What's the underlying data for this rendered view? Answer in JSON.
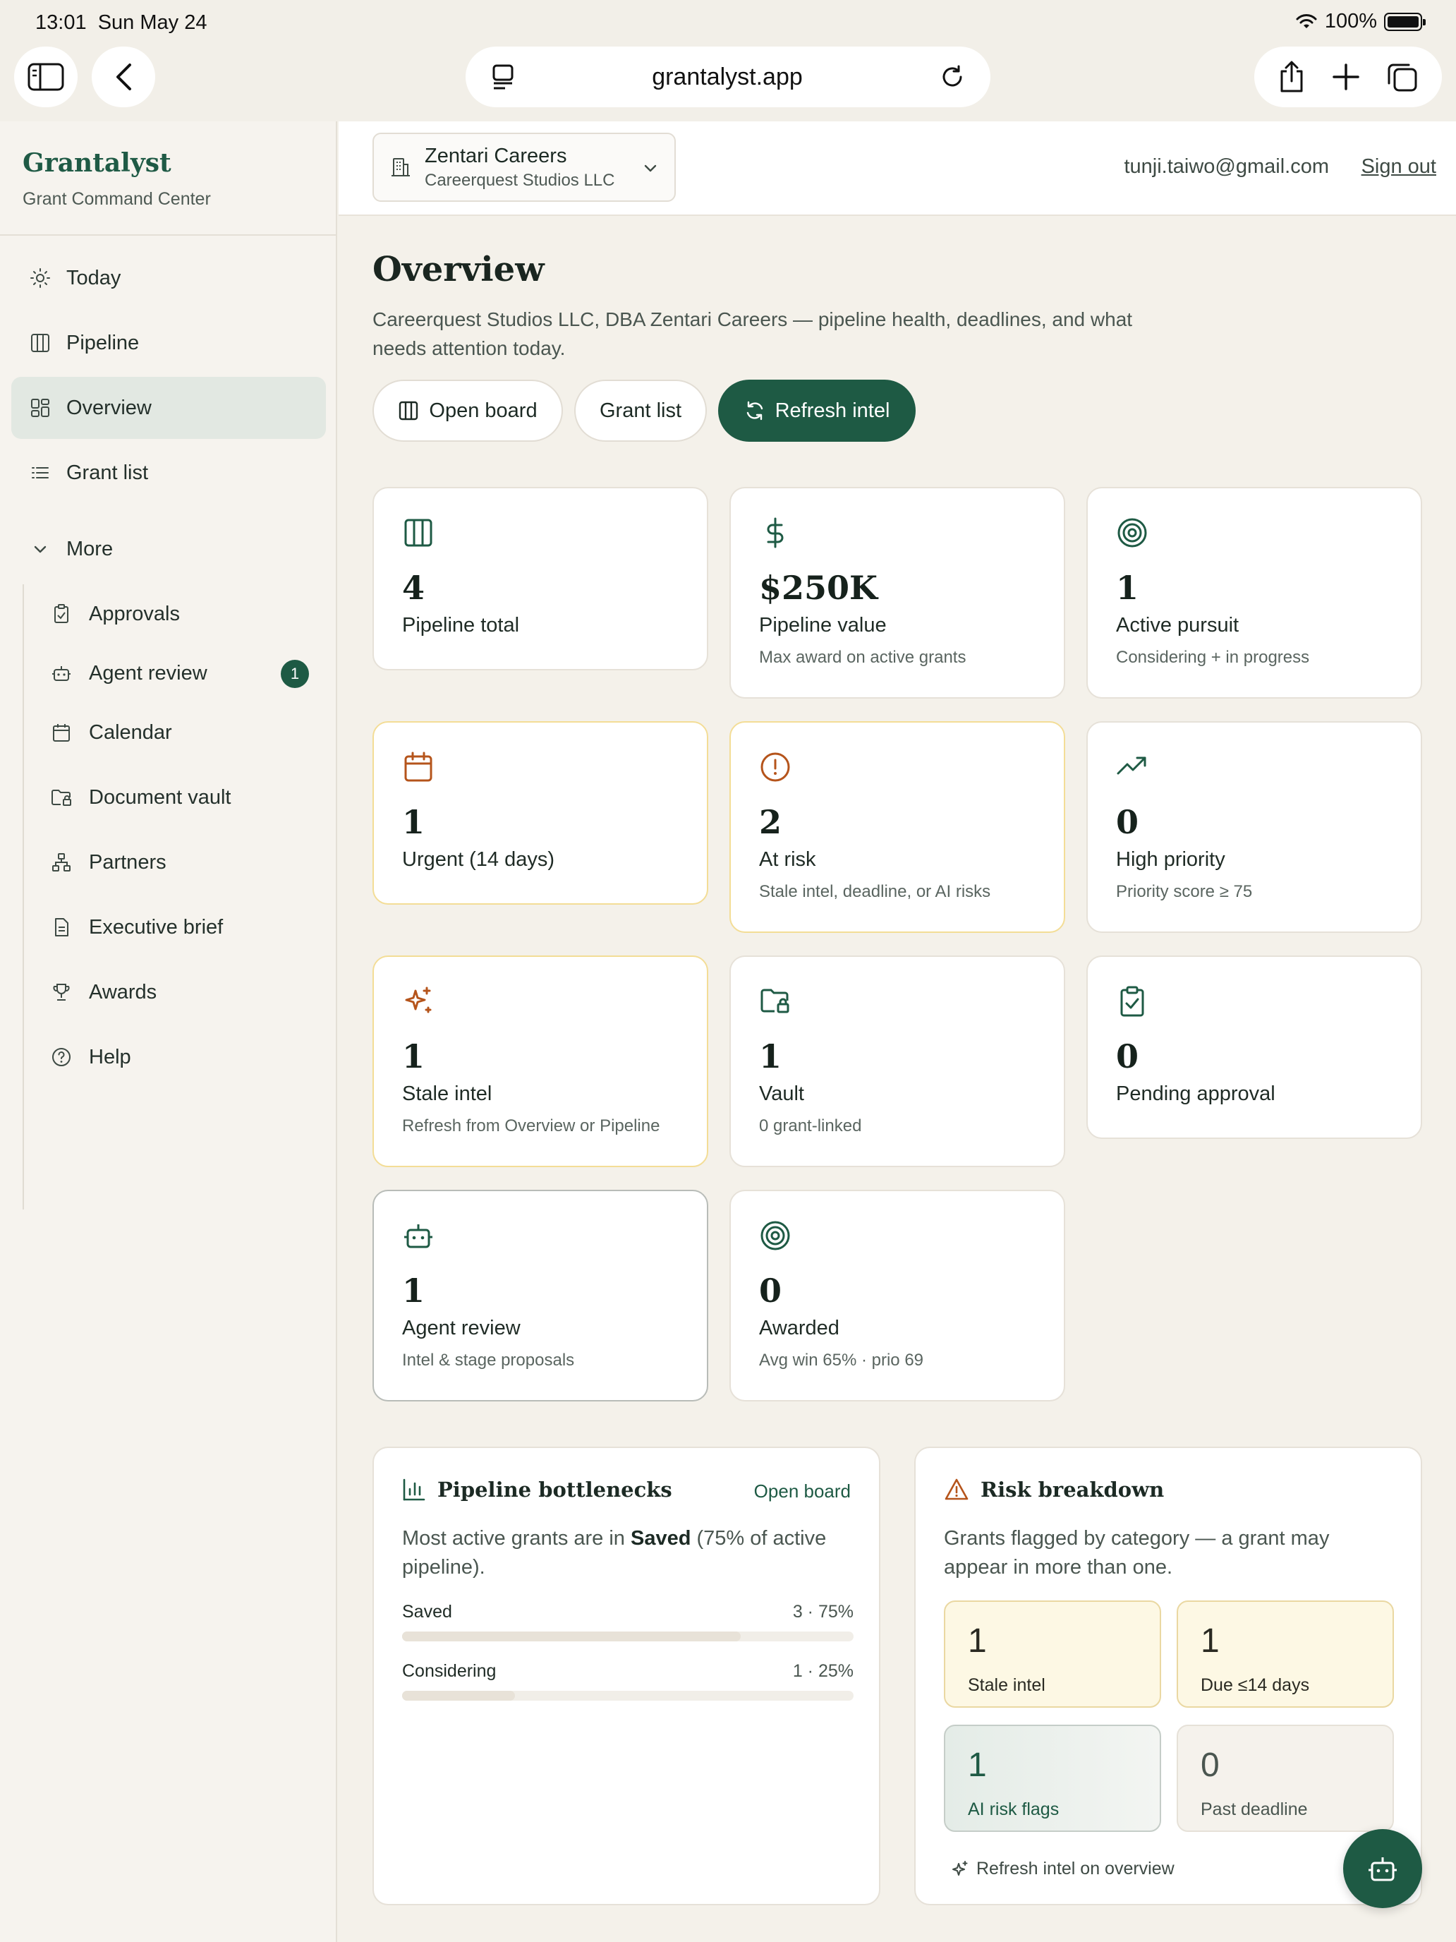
{
  "status": {
    "time": "13:01",
    "date": "Sun May 24",
    "battery": "100%"
  },
  "browser": {
    "url": "grantalyst.app"
  },
  "sidebar": {
    "brand": "Grantalyst",
    "brand_sub": "Grant Command Center",
    "items": [
      {
        "label": "Today",
        "icon": "sun-icon"
      },
      {
        "label": "Pipeline",
        "icon": "columns-icon"
      },
      {
        "label": "Overview",
        "icon": "grid-icon",
        "active": true
      },
      {
        "label": "Grant list",
        "icon": "list-icon"
      }
    ],
    "more_label": "More",
    "more_items": [
      {
        "label": "Approvals",
        "icon": "clipboard-icon"
      },
      {
        "label": "Agent review",
        "icon": "bot-icon",
        "badge": "1"
      },
      {
        "label": "Calendar",
        "icon": "calendar-icon"
      },
      {
        "label": "Document vault",
        "icon": "folder-lock-icon"
      },
      {
        "label": "Partners",
        "icon": "network-icon"
      },
      {
        "label": "Executive brief",
        "icon": "document-icon"
      },
      {
        "label": "Awards",
        "icon": "trophy-icon"
      },
      {
        "label": "Help",
        "icon": "help-icon"
      }
    ]
  },
  "topbar": {
    "org_name": "Zentari Careers",
    "org_legal": "Careerquest Studios LLC",
    "user_email": "tunji.taiwo@gmail.com",
    "sign_out": "Sign out"
  },
  "overview": {
    "title": "Overview",
    "description": "Careerquest Studios LLC, DBA Zentari Careers — pipeline health, deadlines, and what needs attention today.",
    "buttons": {
      "open_board": "Open board",
      "grant_list": "Grant list",
      "refresh_intel": "Refresh intel"
    }
  },
  "stats": [
    {
      "value": "4",
      "label": "Pipeline total",
      "sub": "",
      "icon": "columns-icon"
    },
    {
      "value": "$250K",
      "label": "Pipeline value",
      "sub": "Max award on active grants",
      "icon": "dollar-icon"
    },
    {
      "value": "1",
      "label": "Active pursuit",
      "sub": "Considering + in progress",
      "icon": "target-icon"
    },
    {
      "value": "1",
      "label": "Urgent (14 days)",
      "sub": "",
      "icon": "calendar-icon"
    },
    {
      "value": "2",
      "label": "At risk",
      "sub": "Stale intel, deadline, or AI risks",
      "icon": "alert-circle-icon"
    },
    {
      "value": "0",
      "label": "High priority",
      "sub": "Priority score ≥ 75",
      "icon": "trending-up-icon"
    },
    {
      "value": "1",
      "label": "Stale intel",
      "sub": "Refresh from Overview or Pipeline",
      "icon": "sparkles-icon"
    },
    {
      "value": "1",
      "label": "Vault",
      "sub": "0 grant-linked",
      "icon": "folder-lock-icon"
    },
    {
      "value": "0",
      "label": "Pending approval",
      "sub": "",
      "icon": "clipboard-check-icon"
    },
    {
      "value": "1",
      "label": "Agent review",
      "sub": "Intel & stage proposals",
      "icon": "bot-icon"
    },
    {
      "value": "0",
      "label": "Awarded",
      "sub": "Avg win 65% · prio 69",
      "icon": "target-icon"
    }
  ],
  "bottlenecks": {
    "title": "Pipeline bottlenecks",
    "link": "Open board",
    "desc_pre": "Most active grants are in ",
    "desc_bold": "Saved",
    "desc_post": " (75% of active pipeline).",
    "rows": [
      {
        "label": "Saved",
        "value": "3 · 75%",
        "fraction": 0.75
      },
      {
        "label": "Considering",
        "value": "1 · 25%",
        "fraction": 0.25
      }
    ]
  },
  "risk": {
    "title": "Risk breakdown",
    "desc": "Grants flagged by category — a grant may appear in more than one.",
    "tiles": [
      {
        "value": "1",
        "label": "Stale intel"
      },
      {
        "value": "1",
        "label": "Due ≤14 days"
      },
      {
        "value": "1",
        "label": "AI risk flags"
      },
      {
        "value": "0",
        "label": "Past deadline"
      }
    ],
    "refresh_link": "Refresh intel on overview"
  },
  "colors": {
    "brand": "#1e5a44",
    "warning": "#b5541b",
    "background": "#f4f1ea"
  }
}
